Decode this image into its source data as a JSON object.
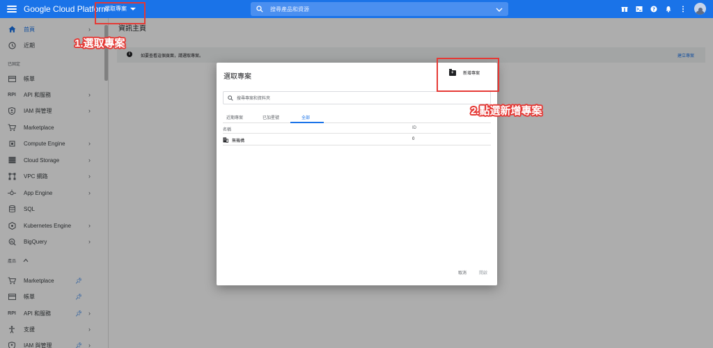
{
  "topbar": {
    "brand": "Google Cloud Platform",
    "project_selector": "選取專案",
    "search_placeholder": "搜尋產品和資源"
  },
  "sidebar": {
    "items": [
      {
        "label": "首頁",
        "icon": "home-icon"
      },
      {
        "label": "近期",
        "icon": "clock-icon"
      }
    ],
    "section_pinned": "已固定",
    "pinned": [
      {
        "label": "帳單",
        "icon": "billing-icon"
      },
      {
        "label": "API 和服務",
        "icon": "api-icon"
      },
      {
        "label": "IAM 與管理",
        "icon": "shield-icon"
      },
      {
        "label": "Marketplace",
        "icon": "cart-icon"
      },
      {
        "label": "Compute Engine",
        "icon": "chip-icon"
      },
      {
        "label": "Cloud Storage",
        "icon": "storage-icon"
      },
      {
        "label": "VPC 網路",
        "icon": "network-icon"
      },
      {
        "label": "App Engine",
        "icon": "app-engine-icon"
      },
      {
        "label": "SQL",
        "icon": "database-icon"
      },
      {
        "label": "Kubernetes Engine",
        "icon": "kubernetes-icon"
      },
      {
        "label": "BigQuery",
        "icon": "bigquery-icon"
      }
    ],
    "section_products": "產品",
    "products": [
      {
        "label": "Marketplace",
        "icon": "cart-icon"
      },
      {
        "label": "帳單",
        "icon": "billing-icon"
      },
      {
        "label": "API 和服務",
        "icon": "api-icon"
      },
      {
        "label": "支援",
        "icon": "support-icon"
      },
      {
        "label": "IAM 與管理",
        "icon": "shield-icon"
      }
    ],
    "api_glyph": "RPI"
  },
  "main": {
    "page_title": "資訊主頁",
    "info_text": "如要查看這個頁面，請選取專案。",
    "info_link": "建立專案"
  },
  "dialog": {
    "title": "選取專案",
    "new_project": "新增專案",
    "search_placeholder": "搜尋專案和資料夾",
    "tabs": [
      "近期專案",
      "已加星號",
      "全部"
    ],
    "columns": [
      "名稱",
      "ID"
    ],
    "rows": [
      {
        "name": "無機構",
        "id": "0"
      }
    ],
    "cancel": "取消",
    "open": "開啟"
  },
  "annotations": {
    "step1": "1.選取專案",
    "step2": "2.點選新增專案"
  },
  "colors": {
    "accent": "#1a73e8",
    "annotation": "#e53935"
  }
}
